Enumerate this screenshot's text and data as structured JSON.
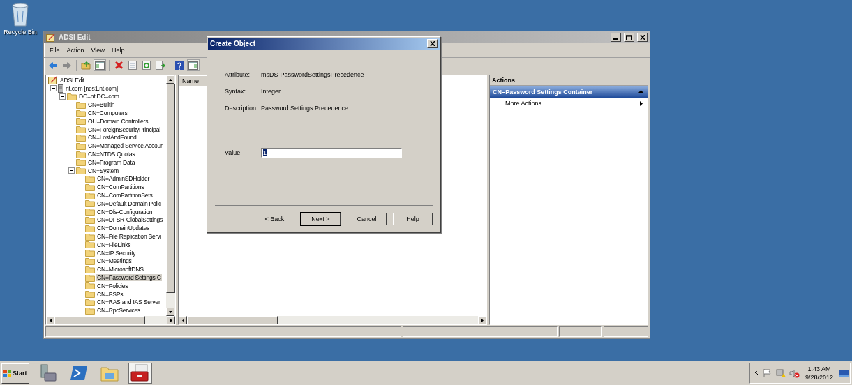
{
  "desktop": {
    "icons": [
      {
        "label": "Recycle Bin"
      }
    ]
  },
  "window": {
    "title": "ADSI Edit",
    "menu": [
      "File",
      "Action",
      "View",
      "Help"
    ],
    "toolbar": [
      {
        "kind": "back",
        "on": false
      },
      {
        "kind": "forward",
        "on": false
      },
      {
        "kind": "sep"
      },
      {
        "kind": "up",
        "on": false
      },
      {
        "kind": "tree",
        "on": true
      },
      {
        "kind": "sep"
      },
      {
        "kind": "delete",
        "on": false
      },
      {
        "kind": "properties",
        "on": false
      },
      {
        "kind": "refresh",
        "on": false
      },
      {
        "kind": "export",
        "on": false
      },
      {
        "kind": "sep"
      },
      {
        "kind": "help",
        "on": false
      },
      {
        "kind": "actionpane",
        "on": true
      }
    ],
    "tree": [
      {
        "label": "ADSI Edit",
        "kind": "root",
        "selected": false,
        "children": [
          {
            "label": "nt.com [nes1.nt.com]",
            "kind": "server",
            "selected": false,
            "expanded": true,
            "children": [
              {
                "label": "DC=nt,DC=com",
                "kind": "folder",
                "selected": false,
                "expanded": true,
                "children": [
                  {
                    "label": "CN=Builtin",
                    "kind": "folder",
                    "selected": false
                  },
                  {
                    "label": "CN=Computers",
                    "kind": "folder",
                    "selected": false
                  },
                  {
                    "label": "OU=Domain Controllers",
                    "kind": "folder",
                    "selected": false
                  },
                  {
                    "label": "CN=ForeignSecurityPrincipal",
                    "kind": "folder",
                    "selected": false
                  },
                  {
                    "label": "CN=LostAndFound",
                    "kind": "folder",
                    "selected": false
                  },
                  {
                    "label": "CN=Managed Service Accour",
                    "kind": "folder",
                    "selected": false
                  },
                  {
                    "label": "CN=NTDS Quotas",
                    "kind": "folder",
                    "selected": false
                  },
                  {
                    "label": "CN=Program Data",
                    "kind": "folder",
                    "selected": false
                  },
                  {
                    "label": "CN=System",
                    "kind": "folder",
                    "selected": false,
                    "expanded": true,
                    "children": [
                      {
                        "label": "CN=AdminSDHolder",
                        "kind": "folder",
                        "selected": false
                      },
                      {
                        "label": "CN=ComPartitions",
                        "kind": "folder",
                        "selected": false
                      },
                      {
                        "label": "CN=ComPartitionSets",
                        "kind": "folder",
                        "selected": false
                      },
                      {
                        "label": "CN=Default Domain Polic",
                        "kind": "folder",
                        "selected": false
                      },
                      {
                        "label": "CN=Dfs-Configuration",
                        "kind": "folder",
                        "selected": false
                      },
                      {
                        "label": "CN=DFSR-GlobalSettings",
                        "kind": "folder",
                        "selected": false
                      },
                      {
                        "label": "CN=DomainUpdates",
                        "kind": "folder",
                        "selected": false
                      },
                      {
                        "label": "CN=File Replication Servi",
                        "kind": "folder",
                        "selected": false
                      },
                      {
                        "label": "CN=FileLinks",
                        "kind": "folder",
                        "selected": false
                      },
                      {
                        "label": "CN=IP Security",
                        "kind": "folder",
                        "selected": false
                      },
                      {
                        "label": "CN=Meetings",
                        "kind": "folder",
                        "selected": false
                      },
                      {
                        "label": "CN=MicrosoftDNS",
                        "kind": "folder",
                        "selected": false
                      },
                      {
                        "label": "CN=Password Settings C",
                        "kind": "folder",
                        "selected": true
                      },
                      {
                        "label": "CN=Policies",
                        "kind": "folder",
                        "selected": false
                      },
                      {
                        "label": "CN=PSPs",
                        "kind": "folder",
                        "selected": false
                      },
                      {
                        "label": "CN=RAS and IAS Server",
                        "kind": "folder",
                        "selected": false
                      },
                      {
                        "label": "CN=RpcServices",
                        "kind": "folder",
                        "selected": false
                      }
                    ]
                  }
                ]
              }
            ]
          }
        ]
      }
    ],
    "list": {
      "columns": [
        "Name"
      ]
    },
    "actions": {
      "title": "Actions",
      "section": "CN=Password Settings Container",
      "expanded": true,
      "items": [
        {
          "label": "More Actions"
        }
      ]
    }
  },
  "dialog": {
    "title": "Create Object",
    "fields": [
      {
        "label": "Attribute:",
        "value": "msDS-PasswordSettingsPrecedence"
      },
      {
        "label": "Syntax:",
        "value": "Integer"
      },
      {
        "label": "Description:",
        "value": "Password Settings Precedence"
      }
    ],
    "input": {
      "label": "Value:",
      "value": "1",
      "text_selected": true
    },
    "buttons": [
      {
        "label": "< Back",
        "default": false
      },
      {
        "label": "Next >",
        "default": true
      },
      {
        "label": "Cancel",
        "default": false
      },
      {
        "label": "Help",
        "default": false
      }
    ]
  },
  "taskbar": {
    "start": "Start",
    "apps": [
      {
        "kind": "server",
        "active": false
      },
      {
        "kind": "shell",
        "active": false
      },
      {
        "kind": "explorer",
        "active": false
      },
      {
        "kind": "toolbox",
        "active": true
      }
    ],
    "tray": {
      "time": "1:43 AM",
      "date": "9/28/2012"
    }
  }
}
